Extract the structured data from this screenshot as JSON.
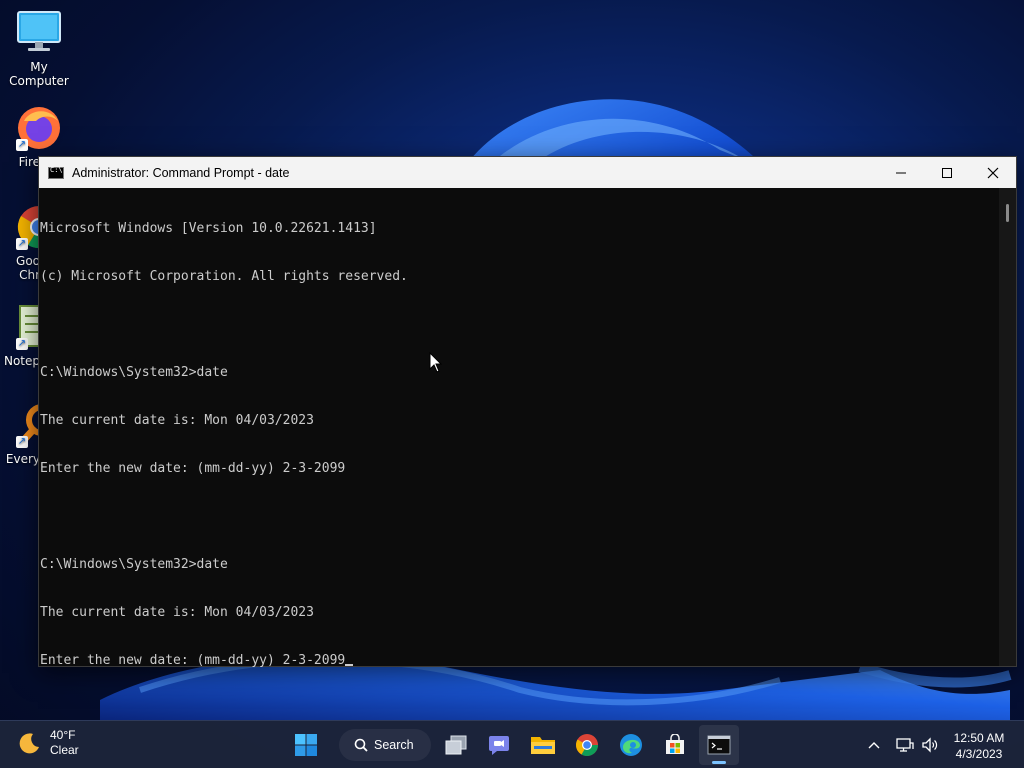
{
  "desktop": {
    "icons": [
      {
        "label": "My Computer"
      },
      {
        "label": "Fire"
      },
      {
        "label": "Goo"
      },
      {
        "label": "Chr"
      },
      {
        "label": "Notep"
      },
      {
        "label": "Every"
      }
    ]
  },
  "window": {
    "title": "Administrator: Command Prompt - date",
    "console_lines": [
      "Microsoft Windows [Version 10.0.22621.1413]",
      "(c) Microsoft Corporation. All rights reserved.",
      "",
      "C:\\Windows\\System32>date",
      "The current date is: Mon 04/03/2023",
      "Enter the new date: (mm-dd-yy) 2-3-2099",
      "",
      "C:\\Windows\\System32>date",
      "The current date is: Mon 04/03/2023",
      "Enter the new date: (mm-dd-yy) 2-3-2099"
    ]
  },
  "taskbar": {
    "weather": {
      "temp": "40°F",
      "condition": "Clear"
    },
    "search_label": "Search",
    "apps": [
      "start-icon",
      "task-view-icon",
      "teams-chat-icon",
      "file-explorer-icon",
      "chrome-icon",
      "edge-icon",
      "store-icon",
      "terminal-icon"
    ],
    "clock": {
      "time": "12:50 AM",
      "date": "4/3/2023"
    }
  },
  "colors": {
    "console_bg": "#0c0c0c",
    "console_text": "#cccccc",
    "titlebar_bg": "#f3f3f3",
    "taskbar_accent": "#7cc3ff"
  }
}
